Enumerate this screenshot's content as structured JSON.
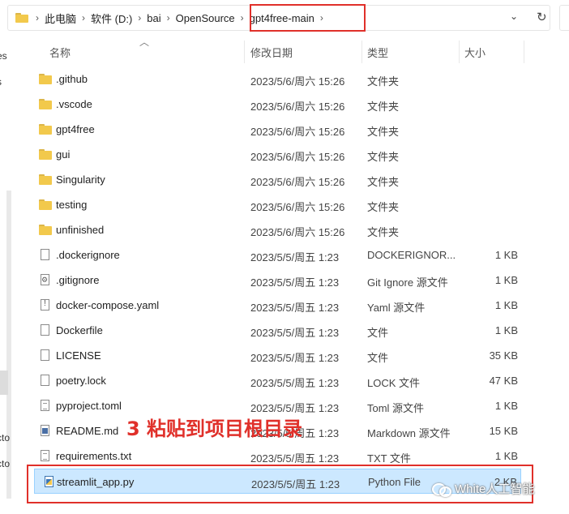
{
  "address": {
    "crumbs": [
      "此电脑",
      "软件 (D:)",
      "bai",
      "OpenSource",
      "gpt4free-main"
    ],
    "dropdown_glyph": "⌄",
    "refresh_glyph": "↻"
  },
  "nav_pane": {
    "fragments": [
      "es",
      "s",
      "cto",
      "cto"
    ]
  },
  "columns": {
    "name": "名称",
    "date": "修改日期",
    "type": "类型",
    "size": "大小"
  },
  "files": [
    {
      "name": ".github",
      "date": "2023/5/6/周六 15:26",
      "type": "文件夹",
      "size": "",
      "icon": "folder-icon"
    },
    {
      "name": ".vscode",
      "date": "2023/5/6/周六 15:26",
      "type": "文件夹",
      "size": "",
      "icon": "folder-icon"
    },
    {
      "name": "gpt4free",
      "date": "2023/5/6/周六 15:26",
      "type": "文件夹",
      "size": "",
      "icon": "folder-icon"
    },
    {
      "name": "gui",
      "date": "2023/5/6/周六 15:26",
      "type": "文件夹",
      "size": "",
      "icon": "folder-icon"
    },
    {
      "name": "Singularity",
      "date": "2023/5/6/周六 15:26",
      "type": "文件夹",
      "size": "",
      "icon": "folder-icon"
    },
    {
      "name": "testing",
      "date": "2023/5/6/周六 15:26",
      "type": "文件夹",
      "size": "",
      "icon": "folder-icon"
    },
    {
      "name": "unfinished",
      "date": "2023/5/6/周六 15:26",
      "type": "文件夹",
      "size": "",
      "icon": "folder-icon"
    },
    {
      "name": ".dockerignore",
      "date": "2023/5/5/周五 1:23",
      "type": "DOCKERIGNOR...",
      "size": "1 KB",
      "icon": "file-icon"
    },
    {
      "name": ".gitignore",
      "date": "2023/5/5/周五 1:23",
      "type": "Git Ignore 源文件",
      "size": "1 KB",
      "icon": "gear-file-icon"
    },
    {
      "name": "docker-compose.yaml",
      "date": "2023/5/5/周五 1:23",
      "type": "Yaml 源文件",
      "size": "1 KB",
      "icon": "exclamation-file-icon"
    },
    {
      "name": "Dockerfile",
      "date": "2023/5/5/周五 1:23",
      "type": "文件",
      "size": "1 KB",
      "icon": "file-icon"
    },
    {
      "name": "LICENSE",
      "date": "2023/5/5/周五 1:23",
      "type": "文件",
      "size": "35 KB",
      "icon": "file-icon"
    },
    {
      "name": "poetry.lock",
      "date": "2023/5/5/周五 1:23",
      "type": "LOCK 文件",
      "size": "47 KB",
      "icon": "file-icon"
    },
    {
      "name": "pyproject.toml",
      "date": "2023/5/5/周五 1:23",
      "type": "Toml 源文件",
      "size": "1 KB",
      "icon": "text-file-icon"
    },
    {
      "name": "README.md",
      "date": "2023/5/5/周五 1:23",
      "type": "Markdown 源文件",
      "size": "15 KB",
      "icon": "markdown-file-icon"
    },
    {
      "name": "requirements.txt",
      "date": "2023/5/5/周五 1:23",
      "type": "TXT 文件",
      "size": "1 KB",
      "icon": "text-file-icon"
    },
    {
      "name": "streamlit_app.py",
      "date": "2023/5/5/周五 1:23",
      "type": "Python File",
      "size": "2 KB",
      "icon": "python-file-icon",
      "selected": true
    }
  ],
  "annotation": "3 粘贴到项目根目录",
  "watermark": "White人工智能",
  "colors": {
    "highlight": "#e0302a",
    "selection": "#cce8ff",
    "folder": "#f2c94c"
  }
}
